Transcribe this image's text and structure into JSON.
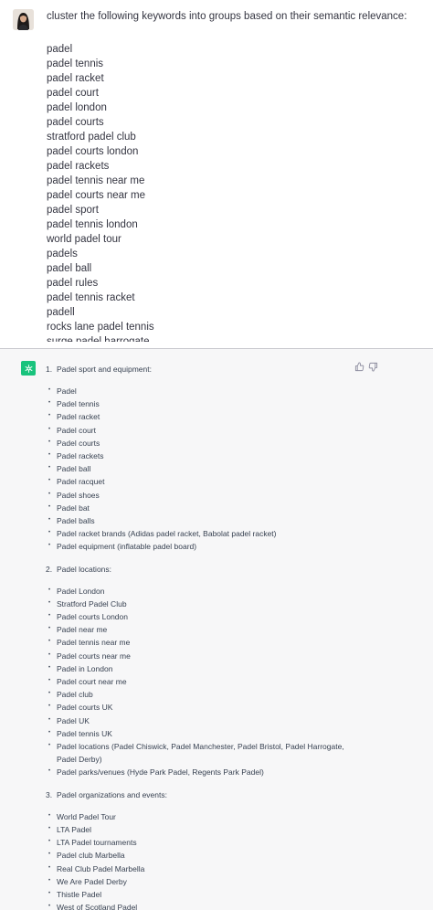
{
  "user": {
    "prompt": "cluster the following keywords into groups based on their semantic relevance:",
    "keywords": [
      "padel",
      "padel tennis",
      "padel racket",
      "padel court",
      "padel london",
      "padel courts",
      "stratford padel club",
      "padel courts london",
      "padel rackets",
      "padel tennis near me",
      "padel courts near me",
      "padel sport",
      "padel tennis london",
      "world padel tour",
      "padels",
      "padel ball",
      "padel rules",
      "padel tennis racket",
      "padell",
      "rocks lane padel tennis",
      "surge padel harrogate"
    ]
  },
  "assistant": {
    "sections": [
      {
        "number": "1.",
        "title": "Padel sport and equipment:",
        "items": [
          "Padel",
          "Padel tennis",
          "Padel racket",
          "Padel court",
          "Padel courts",
          "Padel rackets",
          "Padel ball",
          "Padel racquet",
          "Padel shoes",
          "Padel bat",
          "Padel balls",
          "Padel racket brands (Adidas padel racket, Babolat padel racket)",
          "Padel equipment (inflatable padel board)"
        ]
      },
      {
        "number": "2.",
        "title": "Padel locations:",
        "items": [
          "Padel London",
          "Stratford Padel Club",
          "Padel courts London",
          "Padel near me",
          "Padel tennis near me",
          "Padel courts near me",
          "Padel in London",
          "Padel court near me",
          "Padel club",
          "Padel courts UK",
          "Padel UK",
          "Padel tennis UK",
          "Padel locations (Padel Chiswick, Padel Manchester, Padel Bristol, Padel Harrogate, Padel Derby)",
          "Padel parks/venues (Hyde Park Padel, Regents Park Padel)"
        ]
      },
      {
        "number": "3.",
        "title": "Padel organizations and events:",
        "items": [
          "World Padel Tour",
          "LTA Padel",
          "LTA Padel tournaments",
          "Padel club Marbella",
          "Real Club Padel Marbella",
          "We Are Padel Derby",
          "Thistle Padel",
          "West of Scotland Padel"
        ]
      }
    ]
  },
  "icons": {
    "avatar": "user-avatar",
    "assistant_logo": "openai-logo-icon",
    "thumbs_up": "thumbs-up-icon",
    "thumbs_down": "thumbs-down-icon"
  },
  "colors": {
    "assistant_bg": "#f7f7f8",
    "logo_green": "#19c37d",
    "text": "#374151"
  }
}
